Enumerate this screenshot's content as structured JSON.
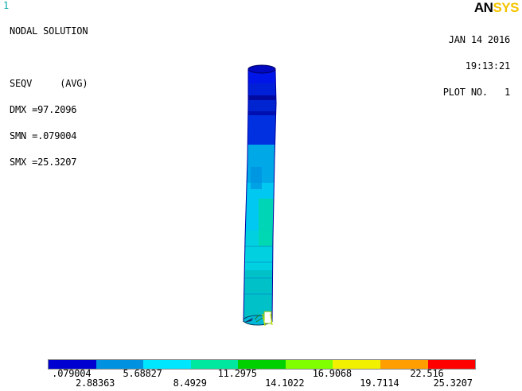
{
  "window_number": "1",
  "header": {
    "title": "NODAL SOLUTION",
    "blank": "",
    "result": "SEQV     (AVG)",
    "dmx": "DMX =97.2096",
    "smn": "SMN =.079004",
    "smx": "SMX =25.3207"
  },
  "plot_info": {
    "date": "JAN 14 2016",
    "time": "19:13:21",
    "plot_no": "PLOT NO.   1"
  },
  "logo": {
    "part1": "AN",
    "part2": "SYS"
  },
  "legend": {
    "colors": [
      "#0000d0",
      "#0092e0",
      "#00e6ff",
      "#00e8a0",
      "#00d000",
      "#80ff00",
      "#f0f000",
      "#ff9e00",
      "#ff0000"
    ],
    "upper_labels": [
      ".079004",
      "5.68827",
      "11.2975",
      "16.9068",
      "22.516"
    ],
    "lower_labels": [
      "2.88363",
      "8.4929",
      "14.1022",
      "19.7114",
      "25.3207"
    ]
  }
}
